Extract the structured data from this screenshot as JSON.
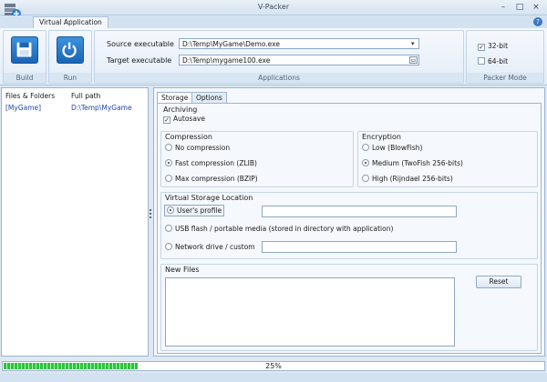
{
  "window": {
    "title": "V-Packer"
  },
  "ribbon": {
    "tab": "Virtual Application",
    "groups": {
      "build": "Build",
      "run": "Run",
      "applications": "Applications",
      "packer_mode": "Packer Mode"
    },
    "source_label": "Source executable",
    "source_value": "D:\\Temp\\MyGame\\Demo.exe",
    "target_label": "Target executable",
    "target_value": "D:\\Temp\\mygame100.exe",
    "mode_32": "32-bit",
    "mode_64": "64-bit"
  },
  "files": {
    "columns": [
      "Files & Folders",
      "Full path"
    ],
    "rows": [
      {
        "name": "[MyGame]",
        "path": "D:\\Temp\\MyGame"
      }
    ]
  },
  "tabs": {
    "storage": "Storage",
    "options": "Options"
  },
  "archiving": {
    "title": "Archiving",
    "autosave": "Autosave"
  },
  "compression": {
    "title": "Compression",
    "options": [
      "No compression",
      "Fast compression (ZLIB)",
      "Max compression (BZIP)"
    ]
  },
  "encryption": {
    "title": "Encryption",
    "options": [
      "Low (BlowFish)",
      "Medium (TwoFish 256-bits)",
      "High (Rijndael 256-bits)"
    ]
  },
  "storage_location": {
    "title": "Virtual Storage Location",
    "options": [
      "User's profile",
      "USB flash / portable media (stored in directory with application)",
      "Network drive / custom"
    ]
  },
  "new_files": {
    "title": "New Files",
    "reset": "Reset"
  },
  "progress": {
    "value": 25,
    "label": "25%"
  },
  "colors": {
    "accent": "#1b63b5",
    "progress": "#2cc43c"
  }
}
